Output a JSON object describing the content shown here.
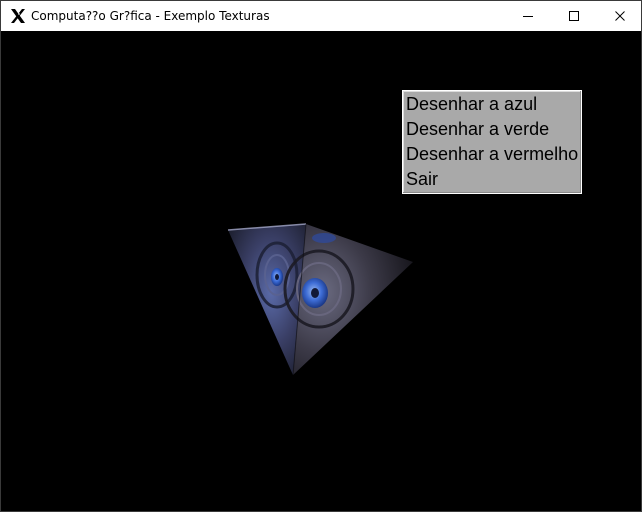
{
  "window": {
    "title": "Computa??o Gr?fica - Exemplo Texturas"
  },
  "menu": {
    "items": [
      {
        "label": "Desenhar a azul"
      },
      {
        "label": "Desenhar a verde"
      },
      {
        "label": "Desenhar a vermelho"
      },
      {
        "label": "Sair"
      }
    ]
  },
  "colors": {
    "canvas_background": "#000000",
    "menu_background": "#a9a9a9",
    "texture_tint": "#3b4a8a"
  }
}
